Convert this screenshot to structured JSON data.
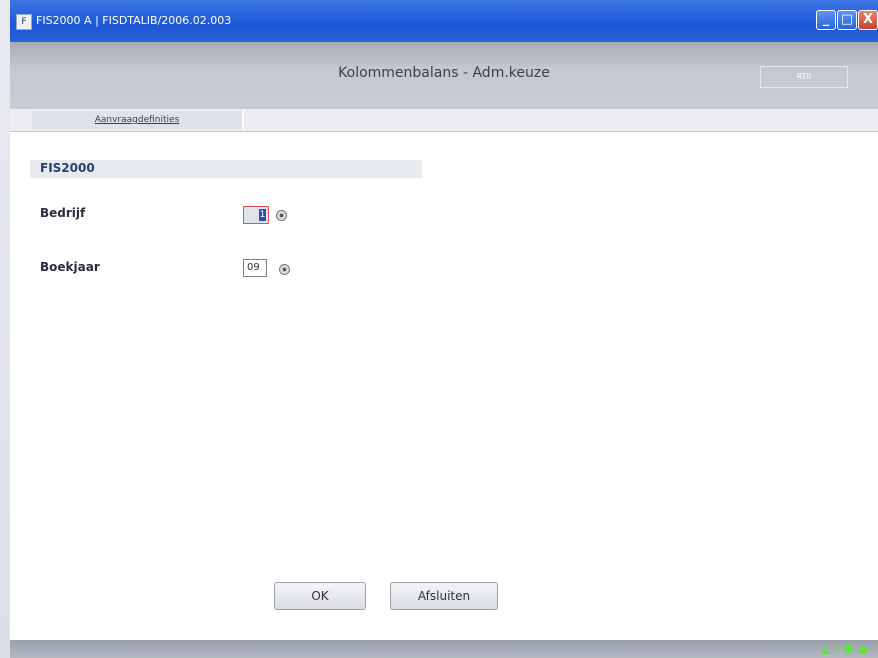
{
  "window": {
    "title": "FIS2000 A | FISDTALIB/2006.02.003",
    "controls": {
      "minimize": "_",
      "maximize": "□",
      "close": "X"
    }
  },
  "header": {
    "caption": "Kolommenbalans - Adm.keuze",
    "sys_button": "RTII"
  },
  "tabs": [
    {
      "label": "Aanvraagdefinities"
    }
  ],
  "section": {
    "title": "FIS2000"
  },
  "form": {
    "bedrijf": {
      "label": "Bedrijf",
      "value": "1"
    },
    "boekjaar": {
      "label": "Boekjaar",
      "value": "09"
    }
  },
  "buttons": {
    "ok": "OK",
    "close": "Afsluiten"
  },
  "colors": {
    "titlebar": "#1c56d4",
    "header": "#c5c8d0",
    "section_bg": "#e6e9ee",
    "section_text": "#2a3f73",
    "focus_border": "#e05050"
  },
  "icons": [
    "app-icon",
    "minimize-icon",
    "maximize-icon",
    "close-icon",
    "lookup-icon",
    "status-icons"
  ]
}
